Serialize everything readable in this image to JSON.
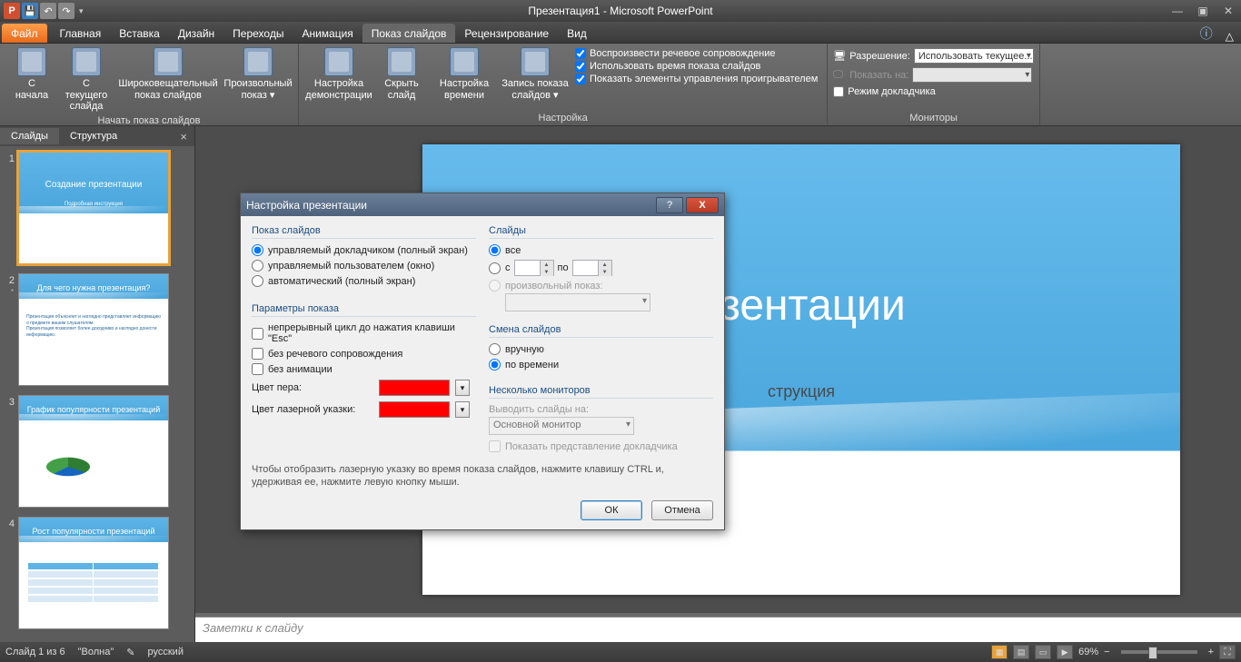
{
  "app": {
    "title": "Презентация1 - Microsoft PowerPoint"
  },
  "menutabs": {
    "file": "Файл",
    "items": [
      "Главная",
      "Вставка",
      "Дизайн",
      "Переходы",
      "Анимация",
      "Показ слайдов",
      "Рецензирование",
      "Вид"
    ],
    "active_index": 5
  },
  "ribbon": {
    "group_start": {
      "label": "Начать показ слайдов",
      "from_beginning": "С\nначала",
      "from_current": "С текущего\nслайда",
      "broadcast": "Широковещательный\nпоказ слайдов",
      "custom": "Произвольный\nпоказ ▾"
    },
    "group_setup": {
      "label": "Настройка",
      "setup": "Настройка\nдемонстрации",
      "hide": "Скрыть\nслайд",
      "rehearse": "Настройка\nвремени",
      "record": "Запись показа\nслайдов ▾",
      "chk_narration": "Воспроизвести речевое сопровождение",
      "chk_timings": "Использовать время показа слайдов",
      "chk_media": "Показать элементы управления проигрывателем"
    },
    "group_monitors": {
      "label": "Мониторы",
      "resolution_lbl": "Разрешение:",
      "resolution_val": "Использовать текущее...",
      "show_on_lbl": "Показать на:",
      "show_on_val": "",
      "presenter_view": "Режим докладчика"
    }
  },
  "leftpane": {
    "tab_slides": "Слайды",
    "tab_outline": "Структура",
    "thumbs": [
      {
        "title": "Создание презентации",
        "sub": "Подробная инструкция"
      },
      {
        "title": "Для чего нужна презентация?"
      },
      {
        "title": "График популярности презентаций"
      },
      {
        "title": "Рост популярности презентаций"
      }
    ]
  },
  "slide": {
    "title": "езентации",
    "subtitle": "струкция"
  },
  "notes": {
    "placeholder": "Заметки к слайду"
  },
  "statusbar": {
    "slide_info": "Слайд 1 из 6",
    "theme": "\"Волна\"",
    "lang": "русский",
    "zoom": "69%"
  },
  "dialog": {
    "title": "Настройка презентации",
    "show_type": {
      "heading": "Показ слайдов",
      "r1": "управляемый докладчиком (полный экран)",
      "r2": "управляемый пользователем (окно)",
      "r3": "автоматический (полный экран)"
    },
    "show_options": {
      "heading": "Параметры показа",
      "c1": "непрерывный цикл до нажатия клавиши \"Esc\"",
      "c2": "без речевого сопровождения",
      "c3": "без анимации",
      "pen": "Цвет пера:",
      "laser": "Цвет лазерной указки:"
    },
    "slides": {
      "heading": "Слайды",
      "all": "все",
      "from": "с",
      "to": "по",
      "custom": "произвольный показ:"
    },
    "advance": {
      "heading": "Смена слайдов",
      "manual": "вручную",
      "timed": "по времени"
    },
    "monitors": {
      "heading": "Несколько мониторов",
      "display_on": "Выводить слайды на:",
      "display_val": "Основной монитор",
      "presenter": "Показать представление докладчика"
    },
    "hint": "Чтобы отобразить лазерную указку во время показа слайдов, нажмите клавишу CTRL и, удерживая ее, нажмите левую кнопку мыши.",
    "ok": "ОК",
    "cancel": "Отмена"
  }
}
